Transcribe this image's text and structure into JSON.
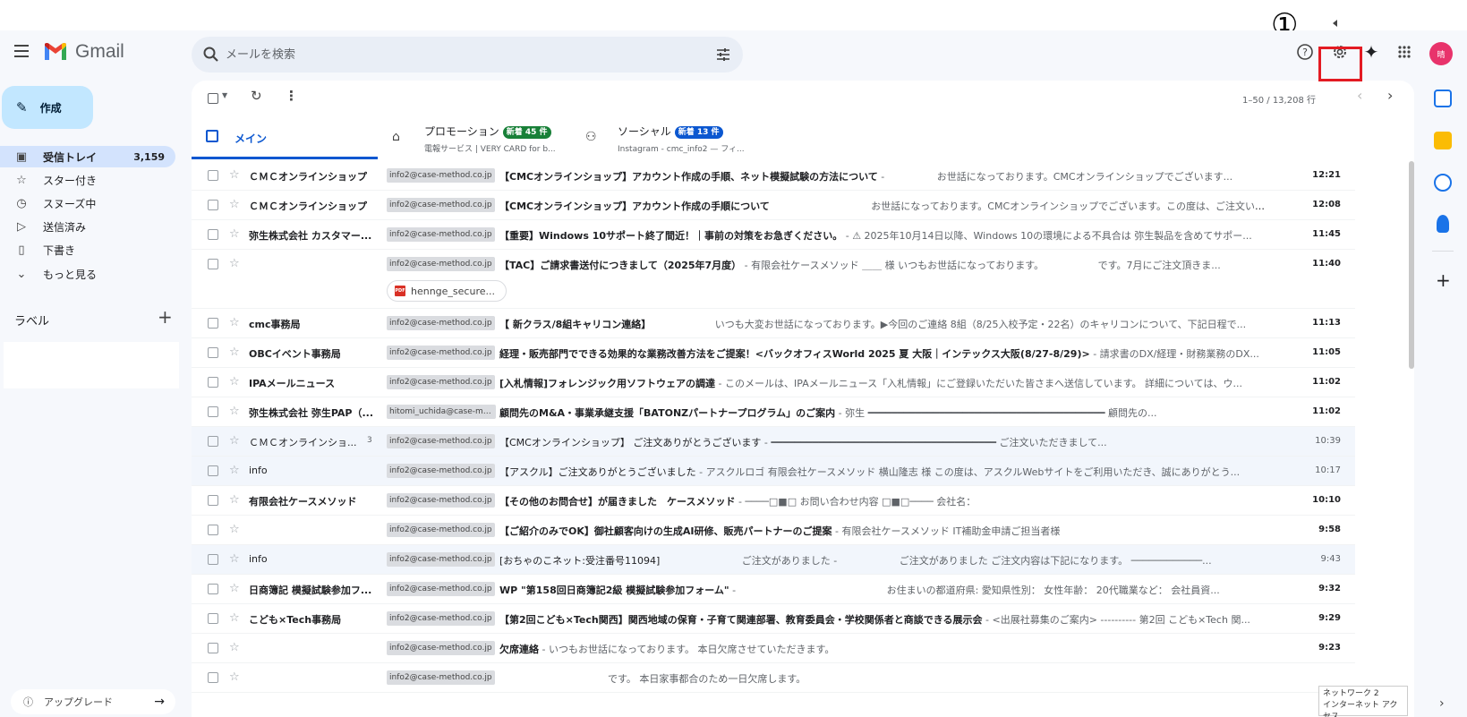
{
  "annotation": {
    "marker": "①"
  },
  "header": {
    "app_name": "Gmail",
    "search_placeholder": "メールを検索"
  },
  "sidebar": {
    "compose_label": "作成",
    "items": [
      {
        "label": "受信トレイ",
        "count": "3,159"
      },
      {
        "label": "スター付き"
      },
      {
        "label": "スヌーズ中"
      },
      {
        "label": "送信済み"
      },
      {
        "label": "下書き"
      },
      {
        "label": "もっと見る"
      }
    ],
    "labels_title": "ラベル",
    "labels_add": "+",
    "upgrade_label": "アップグレード"
  },
  "avatar": {
    "initial": "晴",
    "color": "#e8336b"
  },
  "toolbar": {
    "pager": "1–50 / 13,208 行"
  },
  "tabs": [
    {
      "label": "メイン"
    },
    {
      "label": "プロモーション",
      "badge": "新着 45 件",
      "sub": "電報サービス | VERY CARD for b..."
    },
    {
      "label": "ソーシャル",
      "badge": "新着 13 件",
      "sub": "Instagram - cmc_info2 — フィ..."
    }
  ],
  "emails": [
    {
      "sender": "ＣＭＣオンラインショップ",
      "tag": "info2@case-method.co.jp",
      "subject": "【CMCオンラインショップ】アカウント作成の手順、ネット模擬試験の方法について",
      "snippet": " - 　　　　　お世話になっております。CMCオンラインショップでございます...",
      "time": "12:21"
    },
    {
      "sender": "ＣＭＣオンラインショップ",
      "tag": "info2@case-method.co.jp",
      "subject": "【CMCオンラインショップ】アカウント作成の手順について",
      "snippet": "　　　　　　　　　　 お世話になっております。CMCオンラインショップでございます。この度は、ご注文いた...",
      "time": "12:08"
    },
    {
      "sender": "弥生株式会社 カスタマー...",
      "tag": "info2@case-method.co.jp",
      "subject": "【重要】Windows 10サポート終了間近！｜事前の対策をお急ぎください。",
      "snippet": " - ⚠ 2025年10月14日以降、Windows 10の環境による不具合は 弥生製品を含めてサポー...",
      "time": "11:45"
    },
    {
      "sender": "",
      "tag": "info2@case-method.co.jp",
      "subject": "【TAC】ご請求書送付につきまして（2025年7月度）",
      "snippet": " - 有限会社ケースメソッド ＿＿ 様 いつもお世話になっております。　　　　　　です。7月にご注文頂きま...",
      "time": "11:40",
      "attachment": "hennge_secure..."
    },
    {
      "sender": "cmc事務局",
      "tag": "info2@case-method.co.jp",
      "subject": "【 新クラス/8組キャリコン連絡】",
      "snippet": "　　　　　　　いつも大変お世話になっております。▶今回のご連絡 8組（8/25入校予定・22名）のキャリコンについて、下記日程で...",
      "time": "11:13"
    },
    {
      "sender": "OBCイベント事務局",
      "tag": "info2@case-method.co.jp",
      "subject": "経理・販売部門でできる効果的な業務改善方法をご提案！<バックオフィスWorld 2025 夏 大阪｜インテックス大阪(8/27-8/29)>",
      "snippet": " - 請求書のDX/経理・財務業務のDX...",
      "time": "11:05"
    },
    {
      "sender": "IPAメールニュース",
      "tag": "info2@case-method.co.jp",
      "subject": "[入札情報]フォレンジック用ソフトウェアの調達",
      "snippet": " - このメールは、IPAメールニュース「入札情報」にご登録いただいた皆さまへ送信しています。 詳細については、ウ...",
      "time": "11:02"
    },
    {
      "sender": "弥生株式会社 弥生PAP（...",
      "tag": "hitomi_uchida@case-meth...",
      "subject": "顧問先のM&A・事業承継支援「BATONZパートナープログラム」のご案内",
      "snippet": " - 弥生 ━━━━━━━━━━━━━━━━━━━━━━━━━━━━━━━━━━━━━━━━ 顧問先の...",
      "time": "11:02"
    },
    {
      "sender": "ＣＭＣオンラインショ...",
      "count": "3",
      "tag": "info2@case-method.co.jp",
      "subject": "【CMCオンラインショップ】 ご注文ありがとうございます",
      "snippet": " - ━━━━━━━━━━━━━━━━━━━━━━━━━━━━━━━━━━━━━━ ご注文いただきまして...",
      "time": "10:39",
      "read": true
    },
    {
      "sender": "info",
      "tag": "info2@case-method.co.jp",
      "subject": "【アスクル】ご注文ありがとうございました",
      "snippet": " - アスクルロゴ 有限会社ケースメソッド 横山隆志 様 この度は、アスクルWebサイトをご利用いただき、誠にありがとう...",
      "time": "10:17",
      "read": true
    },
    {
      "sender": "有限会社ケースメソッド",
      "tag": "info2@case-method.co.jp",
      "subject": "【その他のお問合せ】が届きました　ケースメソッド",
      "snippet": " - ────□■□ お問い合わせ内容 □■□──── 会社名：",
      "time": "10:10"
    },
    {
      "sender": "",
      "tag": "info2@case-method.co.jp",
      "subject": "【ご紹介のみでOK】御社顧客向けの生成AI研修、販売パートナーのご提案",
      "snippet": " - 有限会社ケースメソッド IT補助金申請ご担当者様",
      "time": "9:58"
    },
    {
      "sender": "info",
      "tag": "info2@case-method.co.jp",
      "subject": "[おちゃのこネット:受注番号11094]",
      "snippet": "　　　　　　　　 ご注文がありました - 　　　　　　ご注文がありました ご注文内容は下記になります。 ────────────...",
      "time": "9:43",
      "read": true
    },
    {
      "sender": "日商簿記 模擬試験参加フ...",
      "tag": "info2@case-method.co.jp",
      "subject": "WP \"第158回日商簿記2級 模擬試験参加フォーム\"",
      "snippet": " - 　　　　　　　　　　　　　　　お住まいの都道府県: 愛知県性別： 女性年齢： 20代職業など： 会社員資...",
      "time": "9:32"
    },
    {
      "sender": "こども×Tech事務局",
      "tag": "info2@case-method.co.jp",
      "subject": "【第2回こども×Tech関西】関西地域の保育・子育て関連部署、教育委員会・学校関係者と商談できる展示会",
      "snippet": " - <出展社募集のご案内> ---------- 第2回 こども×Tech 関...",
      "time": "9:29"
    },
    {
      "sender": "",
      "tag": "info2@case-method.co.jp",
      "subject": "欠席連絡",
      "snippet": " - いつもお世話になっております。 本日欠席させていただきます。",
      "time": "9:23"
    },
    {
      "sender": "",
      "tag": "info2@case-method.co.jp",
      "subject": "",
      "snippet": "　　　　　　　　　　　です。 本日家事都合のため一日欠席します。",
      "time": ""
    }
  ],
  "network_tooltip": {
    "line1": "ネットワーク 2",
    "line2": "インターネット アクセス"
  }
}
